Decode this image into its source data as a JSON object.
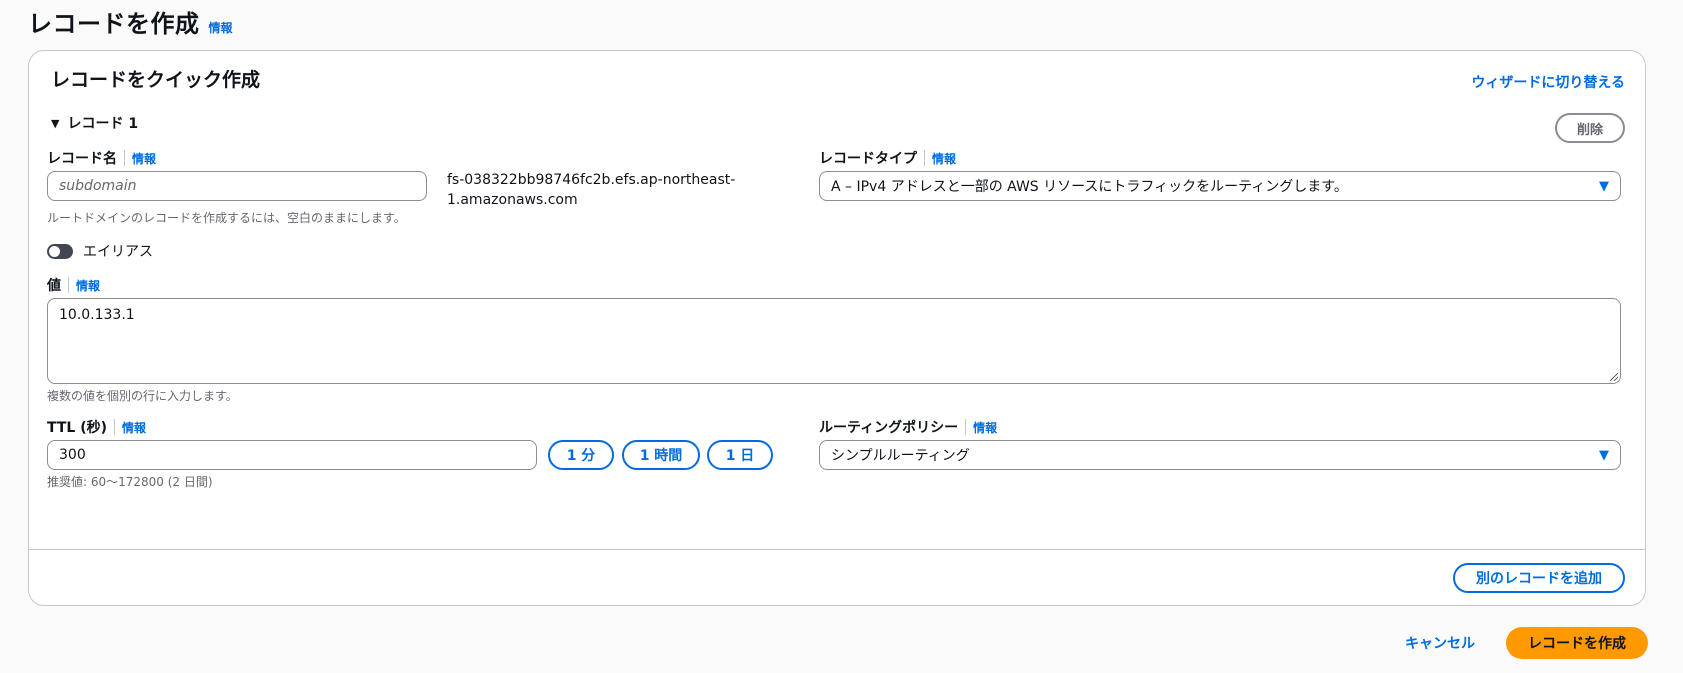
{
  "page": {
    "title": "レコードを作成",
    "info": "情報"
  },
  "quick_create": {
    "title": "レコードをクイック作成",
    "wizard_link": "ウィザードに切り替える",
    "record_section": "レコード 1",
    "delete_button": "削除"
  },
  "record_name": {
    "label": "レコード名",
    "info": "情報",
    "placeholder": "subdomain",
    "value": "",
    "domain_suffix_line1": "fs-038322bb98746fc2b.efs.ap-northeast-",
    "domain_suffix_line2": "1.amazonaws.com",
    "hint": "ルートドメインのレコードを作成するには、空白のままにします。"
  },
  "record_type": {
    "label": "レコードタイプ",
    "info": "情報",
    "selected": "A – IPv4 アドレスと一部の AWS リソースにトラフィックをルーティングします。"
  },
  "alias": {
    "label": "エイリアス",
    "enabled": false
  },
  "value": {
    "label": "値",
    "info": "情報",
    "text": "10.0.133.1",
    "hint": "複数の値を個別の行に入力します。"
  },
  "ttl": {
    "label": "TTL (秒)",
    "info": "情報",
    "value": "300",
    "presets": [
      "1 分",
      "1 時間",
      "1 日"
    ],
    "hint": "推奨値: 60〜172800 (2 日間)"
  },
  "routing_policy": {
    "label": "ルーティングポリシー",
    "info": "情報",
    "selected": "シンプルルーティング"
  },
  "add_record_button": "別のレコードを追加",
  "footer": {
    "cancel": "キャンセル",
    "create": "レコードを作成"
  },
  "colors": {
    "link": "#006ce0",
    "primary_button": "#ff9900",
    "border": "#8c8c94"
  }
}
